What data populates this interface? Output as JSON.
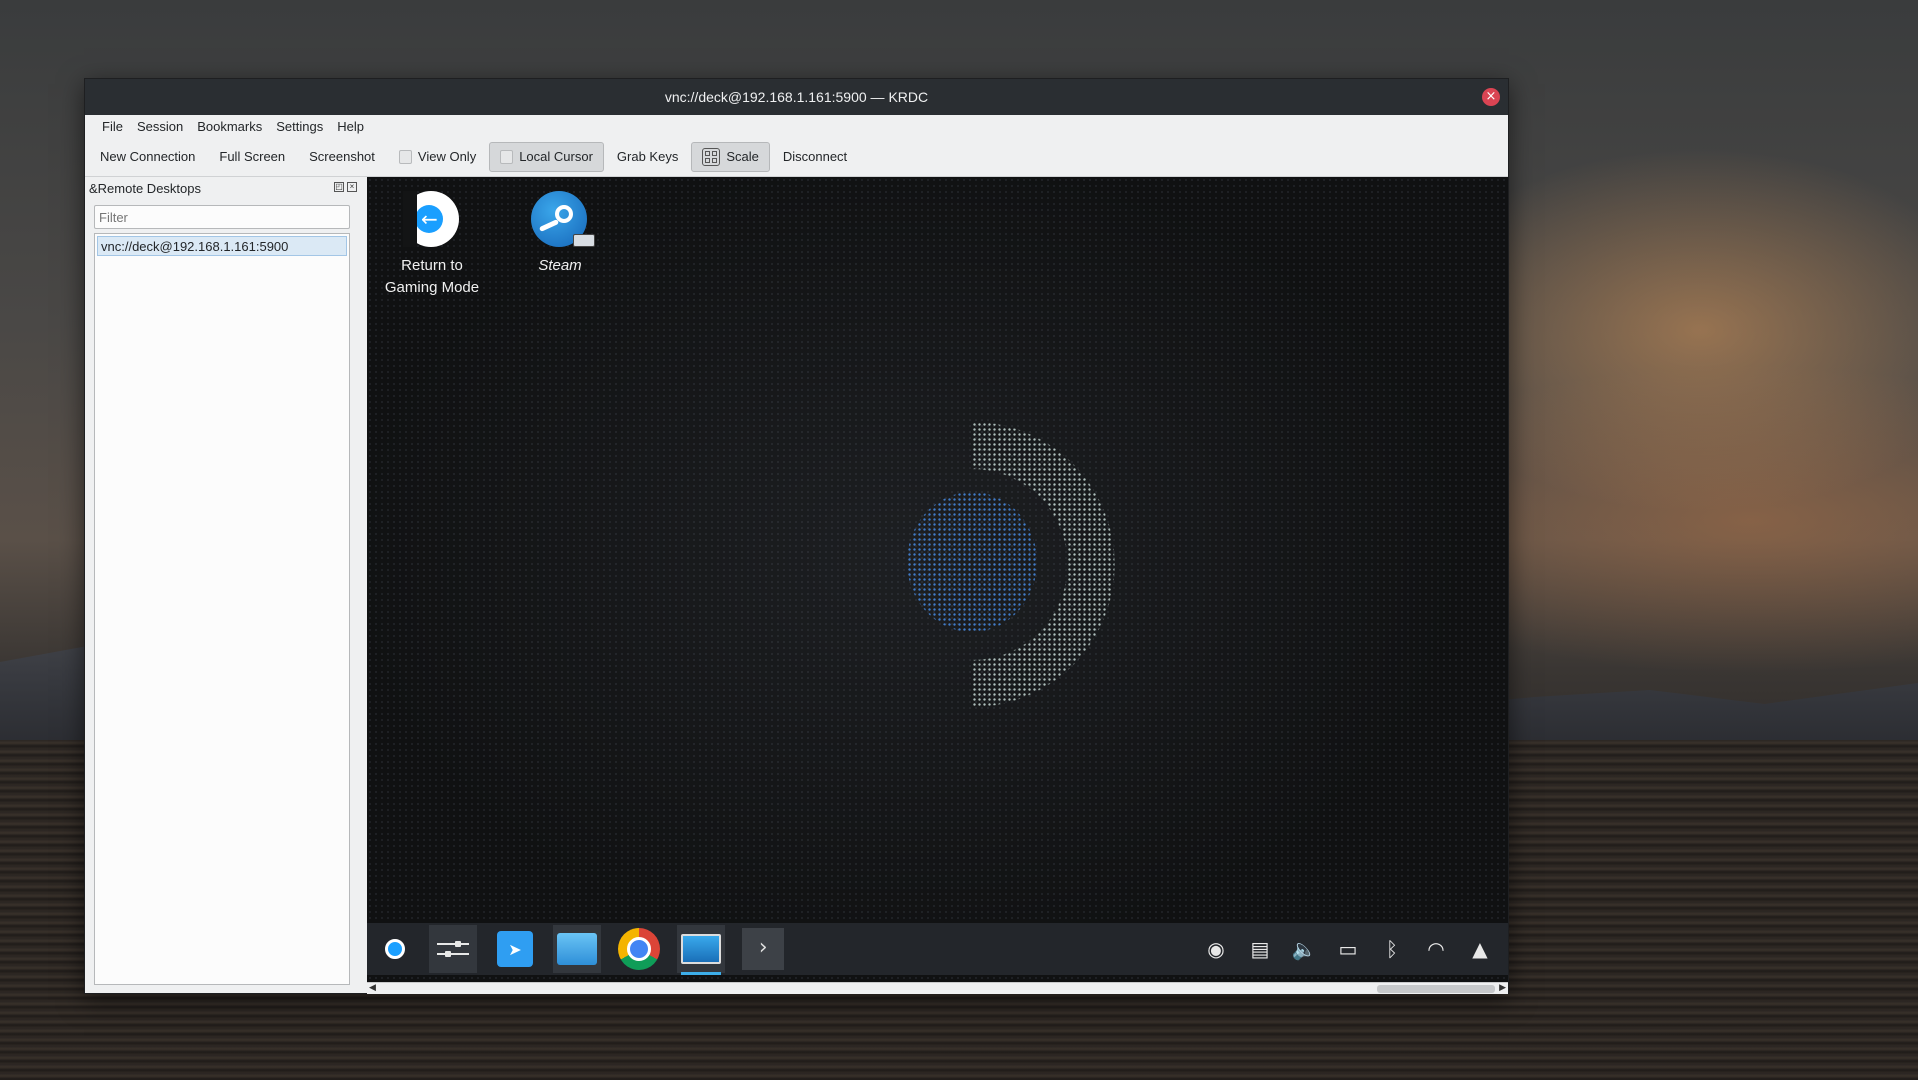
{
  "window": {
    "title": "vnc://deck@192.168.1.161:5900 — KRDC",
    "close_glyph": "×"
  },
  "menubar": {
    "items": [
      "File",
      "Session",
      "Bookmarks",
      "Settings",
      "Help"
    ]
  },
  "toolbar": {
    "new_connection": "New Connection",
    "full_screen": "Full Screen",
    "screenshot": "Screenshot",
    "view_only": "View Only",
    "local_cursor": "Local Cursor",
    "grab_keys": "Grab Keys",
    "scale": "Scale",
    "disconnect": "Disconnect",
    "checked": [
      "Local Cursor",
      "Scale"
    ]
  },
  "sidebar": {
    "title": "&Remote Desktops",
    "filter_placeholder": "Filter",
    "connections": [
      "vnc://deck@192.168.1.161:5900"
    ]
  },
  "remote_desktop": {
    "icons": [
      {
        "name": "return-to-gaming-mode",
        "line1": "Return to",
        "line2": "Gaming Mode"
      },
      {
        "name": "steam",
        "label": "Steam"
      }
    ],
    "taskbar_apps": [
      "steam-deck-menu",
      "system-settings",
      "discover",
      "dolphin-files",
      "google-chrome",
      "krdc",
      "konsole"
    ],
    "tray_icons": [
      "steam",
      "clipboard",
      "volume",
      "battery",
      "bluetooth",
      "wifi",
      "expand-tray"
    ]
  },
  "colors": {
    "accent": "#3daee9",
    "titlebar": "#2a2e32",
    "close": "#da4453"
  }
}
